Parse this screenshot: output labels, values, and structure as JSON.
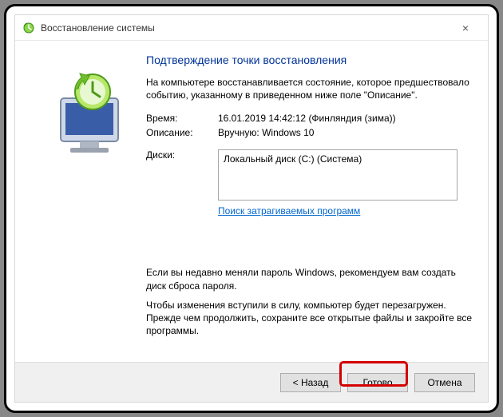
{
  "window": {
    "title": "Восстановление системы",
    "close_symbol": "×"
  },
  "heading": "Подтверждение точки восстановления",
  "intro": "На компьютере восстанавливается состояние, которое предшествовало событию, указанному в приведенном ниже поле \"Описание\".",
  "rows": {
    "time_label": "Время:",
    "time_value": "16.01.2019 14:42:12 (Финляндия (зима))",
    "desc_label": "Описание:",
    "desc_value": "Вручную: Windows 10",
    "disks_label": "Диски:",
    "disks_value": "Локальный диск (C:) (Система)"
  },
  "scan_link": "Поиск затрагиваемых программ",
  "note_p1": "Если вы недавно меняли пароль Windows, рекомендуем вам создать диск сброса пароля.",
  "note_p2": "Чтобы изменения вступили в силу, компьютер будет перезагружен. Прежде чем продолжить, сохраните все открытые файлы и закройте все программы.",
  "buttons": {
    "back": "< Назад",
    "finish": "Готово",
    "cancel": "Отмена"
  }
}
